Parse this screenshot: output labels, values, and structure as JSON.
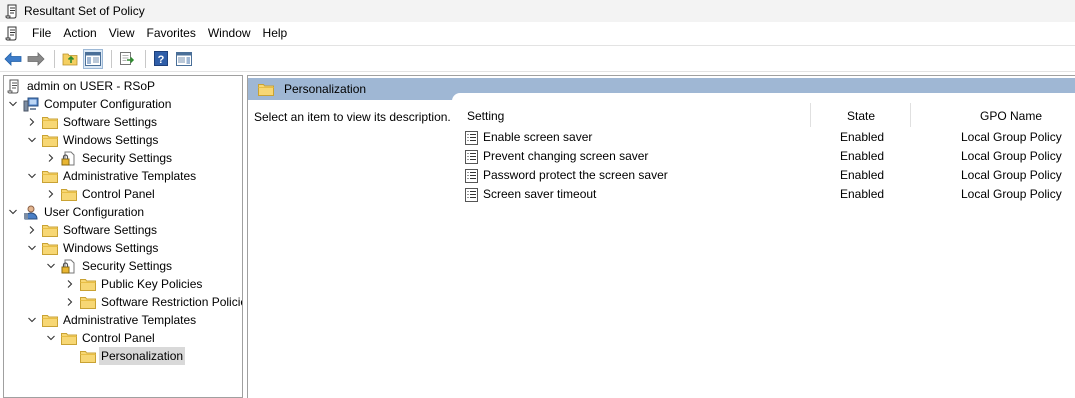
{
  "window": {
    "title": "Resultant Set of Policy",
    "icon": "rsop-scroll-icon"
  },
  "menubar": {
    "icon": "rsop-scroll-icon",
    "items": [
      "File",
      "Action",
      "View",
      "Favorites",
      "Window",
      "Help"
    ]
  },
  "toolbar": {
    "buttons": [
      "back-arrow-icon",
      "forward-arrow-icon",
      "up-folder-icon",
      "show-hide-tree-icon",
      "export-list-icon",
      "help-icon",
      "show-hide-action-pane-icon"
    ]
  },
  "tree": {
    "root": "admin on USER - RSoP",
    "computer_configuration": "Computer Configuration",
    "cc_software_settings": "Software Settings",
    "cc_windows_settings": "Windows Settings",
    "cc_security_settings": "Security Settings",
    "cc_administrative_templates": "Administrative Templates",
    "cc_control_panel": "Control Panel",
    "user_configuration": "User Configuration",
    "uc_software_settings": "Software Settings",
    "uc_windows_settings": "Windows Settings",
    "uc_security_settings": "Security Settings",
    "uc_public_key_policies": "Public Key Policies",
    "uc_software_restriction": "Software Restriction Policie",
    "uc_administrative_templates": "Administrative Templates",
    "uc_control_panel": "Control Panel",
    "uc_personalization": "Personalization"
  },
  "details": {
    "header_title": "Personalization",
    "description": "Select an item to view its description.",
    "columns": {
      "setting": "Setting",
      "state": "State",
      "gpo_name": "GPO Name"
    },
    "rows": [
      {
        "setting": "Enable screen saver",
        "state": "Enabled",
        "gpo": "Local Group Policy"
      },
      {
        "setting": "Prevent changing screen saver",
        "state": "Enabled",
        "gpo": "Local Group Policy"
      },
      {
        "setting": "Password protect the screen saver",
        "state": "Enabled",
        "gpo": "Local Group Policy"
      },
      {
        "setting": "Screen saver timeout",
        "state": "Enabled",
        "gpo": "Local Group Policy"
      }
    ]
  },
  "colors": {
    "header_band": "#9fb7d4",
    "folder": "#f4cf61",
    "selection": "#d9d9d9"
  }
}
